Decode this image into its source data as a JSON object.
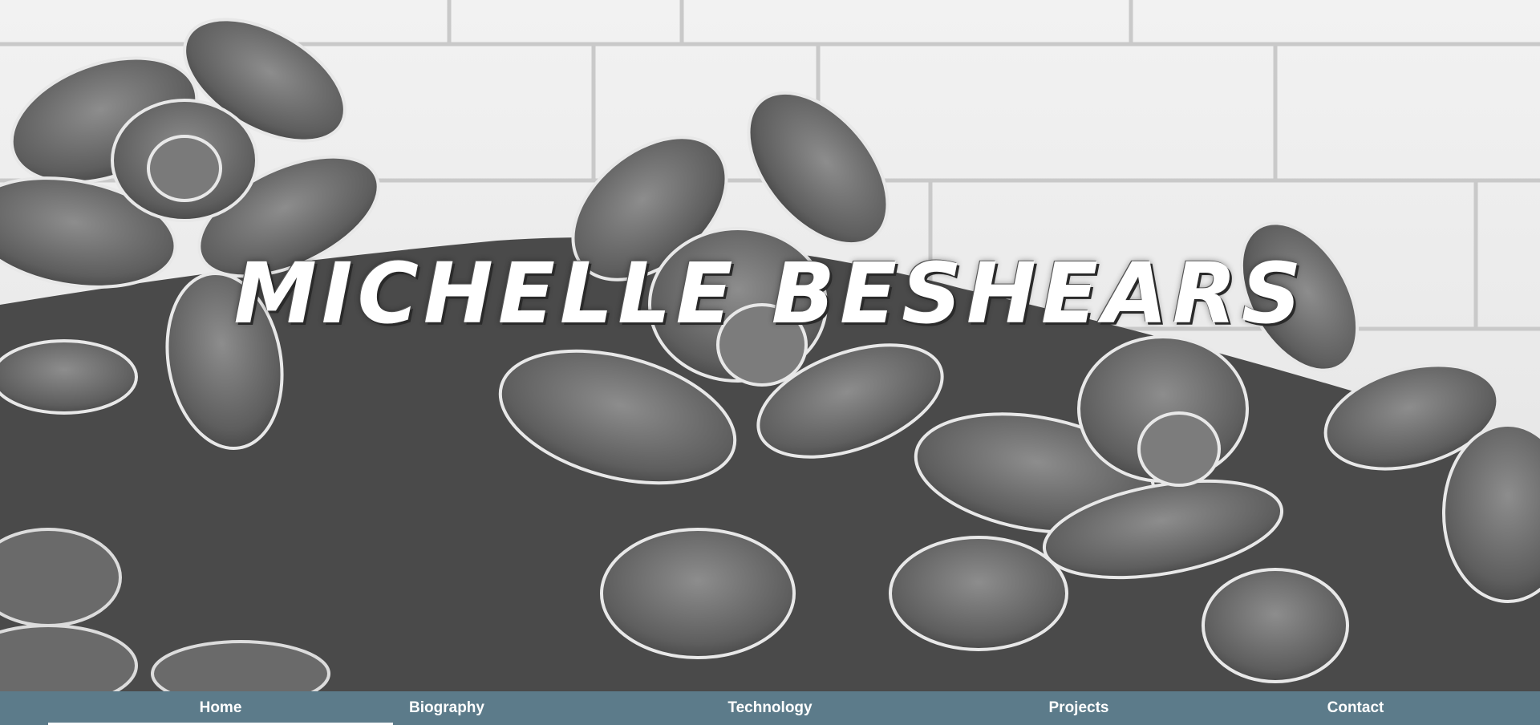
{
  "hero": {
    "title": "MICHELLE BESHEARS"
  },
  "nav": {
    "items": [
      {
        "label": "Home",
        "active": true
      },
      {
        "label": "Biography",
        "active": false
      },
      {
        "label": "Technology",
        "active": false
      },
      {
        "label": "Projects",
        "active": false
      },
      {
        "label": "Contact",
        "active": false
      }
    ]
  },
  "colors": {
    "nav_background": "#5c7b8a",
    "nav_text": "#ffffff",
    "title_text": "#ffffff"
  }
}
